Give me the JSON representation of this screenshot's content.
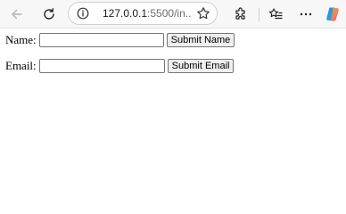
{
  "browser": {
    "url_host": "127.0.0.1",
    "url_rest": ":5500/in...",
    "icons": {
      "back": "back-arrow-icon",
      "refresh": "refresh-icon",
      "site_info": "site-info-icon",
      "favorite": "star-icon",
      "extensions": "extensions-icon",
      "favorites": "favorites-icon",
      "more": "more-icon",
      "copilot": "copilot-icon"
    }
  },
  "form": {
    "name_label": "Name:",
    "name_value": "",
    "name_button": "Submit Name",
    "email_label": "Email:",
    "email_value": "",
    "email_button": "Submit Email"
  }
}
